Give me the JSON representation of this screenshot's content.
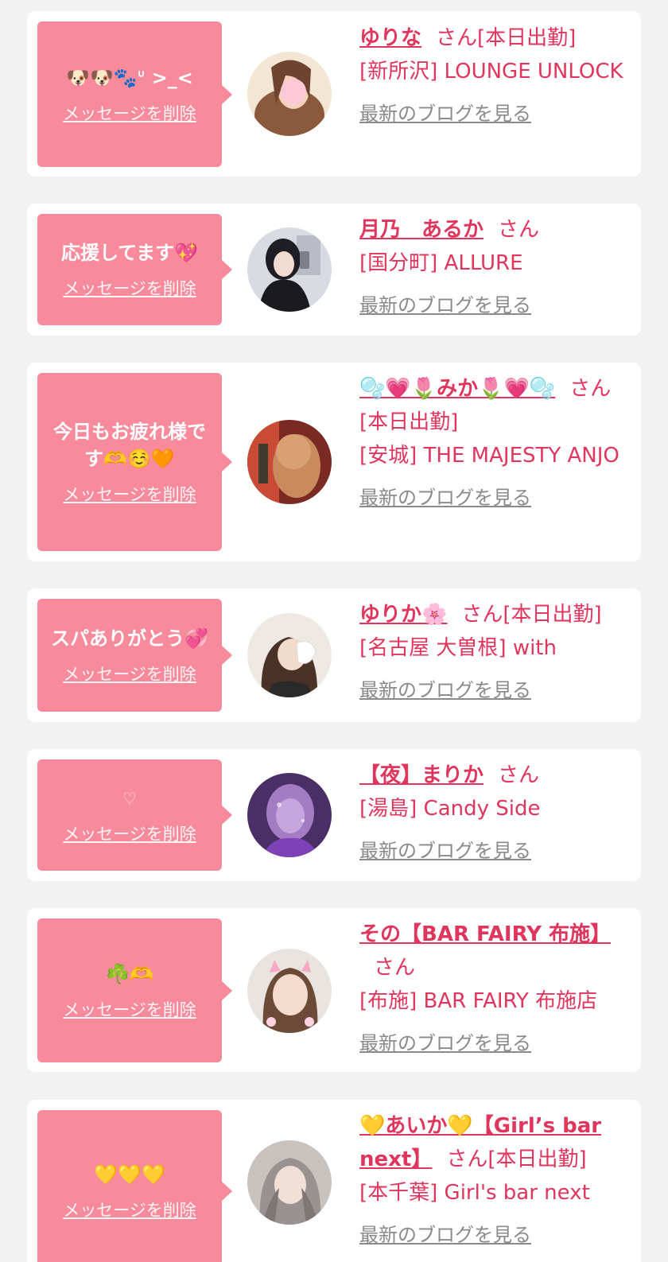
{
  "common": {
    "delete_label": "メッセージを削除",
    "blog_label": "最新のブログを見る",
    "san_label": "さん"
  },
  "items": [
    {
      "message": "🐶🐶🐾ᐡ >_<",
      "name": "ゆりな",
      "working": "[本日出勤]",
      "area": "[新所沢] LOUNGE UNLOCK"
    },
    {
      "message": "応援してます💖",
      "name": "月乃　あるか",
      "working": "",
      "area": "[国分町] ALLURE"
    },
    {
      "message": "今日もお疲れ様です🫶☺️🧡",
      "name": "🫧💗🌷みか🌷💗🫧",
      "working": "[本日出勤]",
      "area": "[安城] THE MAJESTY ANJO"
    },
    {
      "message": "スパありがとう💞",
      "name": "ゆりか🌸",
      "working": "[本日出勤]",
      "area": "[名古屋 大曽根] with"
    },
    {
      "message": "♡",
      "name": "【夜】まりか",
      "working": "",
      "area": "[湯島] Candy Side"
    },
    {
      "message": "☘️🫶",
      "name": "その【BAR FAIRY 布施】",
      "working": "",
      "area": "[布施] BAR FAIRY 布施店"
    },
    {
      "message": "💛💛💛",
      "name": "💛あいか💛【Girl’s bar next】",
      "working": "[本日出勤]",
      "area": "[本千葉] Girl's bar next"
    }
  ]
}
